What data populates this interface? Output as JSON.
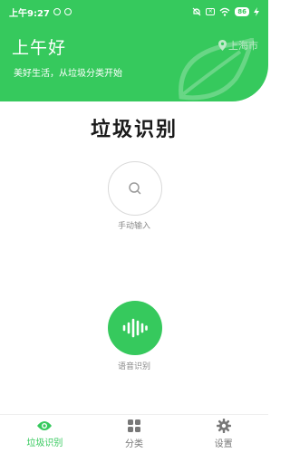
{
  "status_bar": {
    "time": "上午9:27",
    "battery": "86"
  },
  "header": {
    "greeting": "上午好",
    "subtitle": "美好生活，从垃圾分类开始",
    "location": "上海市",
    "location_icon": "map-pin-icon"
  },
  "main": {
    "title": "垃圾识别",
    "manual_label": "手动输入",
    "voice_label": "语音识别"
  },
  "nav": {
    "items": [
      {
        "label": "垃圾识别",
        "icon": "eye-icon",
        "active": true
      },
      {
        "label": "分类",
        "icon": "grid-icon",
        "active": false
      },
      {
        "label": "设置",
        "icon": "gear-icon",
        "active": false
      }
    ]
  },
  "colors": {
    "brand": "#36c95d",
    "nav_inactive": "#777777"
  }
}
